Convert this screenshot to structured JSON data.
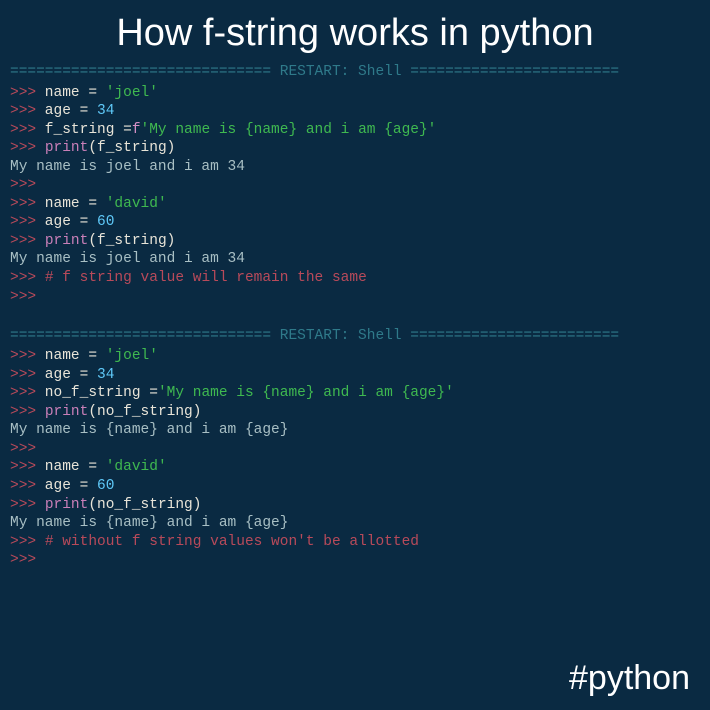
{
  "title": "How f-string works in python",
  "hashtag": "#python",
  "restart1": "============================== RESTART: Shell ========================",
  "restart2": "============================== RESTART: Shell ========================",
  "b1": {
    "l1": {
      "prompt": ">>>",
      "var": " name ",
      "eq": "= ",
      "str": "'joel'"
    },
    "l2": {
      "prompt": ">>>",
      "var": " age ",
      "eq": "= ",
      "num": "34"
    },
    "l3": {
      "prompt": ">>>",
      "var": " f_string ",
      "eq": "=",
      "kw": "f",
      "str": "'My name is {name} and i am {age}'"
    },
    "l4": {
      "prompt": ">>>",
      "sp": " ",
      "func": "print",
      "po": "(",
      "arg": "f_string",
      "pc": ")"
    },
    "l5": "My name is joel and i am 34",
    "l6": ">>>",
    "l7": {
      "prompt": ">>>",
      "var": " name ",
      "eq": "= ",
      "str": "'david'"
    },
    "l8": {
      "prompt": ">>>",
      "var": " age ",
      "eq": "= ",
      "num": "60"
    },
    "l9": {
      "prompt": ">>>",
      "sp": " ",
      "func": "print",
      "po": "(",
      "arg": "f_string",
      "pc": ")"
    },
    "l10": "My name is joel and i am 34",
    "l11": {
      "prompt": ">>> ",
      "comment": "# f string value will remain the same"
    },
    "l12": ">>>"
  },
  "b2": {
    "l1": {
      "prompt": ">>>",
      "var": " name ",
      "eq": "= ",
      "str": "'joel'"
    },
    "l2": {
      "prompt": ">>>",
      "var": " age ",
      "eq": "= ",
      "num": "34"
    },
    "l3": {
      "prompt": ">>>",
      "var": " no_f_string ",
      "eq": "=",
      "str": "'My name is {name} and i am {age}'"
    },
    "l4": {
      "prompt": ">>>",
      "sp": " ",
      "func": "print",
      "po": "(",
      "arg": "no_f_string",
      "pc": ")"
    },
    "l5": "My name is {name} and i am {age}",
    "l6": ">>>",
    "l7": {
      "prompt": ">>>",
      "var": " name ",
      "eq": "= ",
      "str": "'david'"
    },
    "l8": {
      "prompt": ">>>",
      "var": " age ",
      "eq": "= ",
      "num": "60"
    },
    "l9": {
      "prompt": ">>>",
      "sp": " ",
      "func": "print",
      "po": "(",
      "arg": "no_f_string",
      "pc": ")"
    },
    "l10": "My name is {name} and i am {age}",
    "l11": {
      "prompt": ">>> ",
      "comment": "# without f string values won't be allotted"
    },
    "l12": ">>>"
  }
}
